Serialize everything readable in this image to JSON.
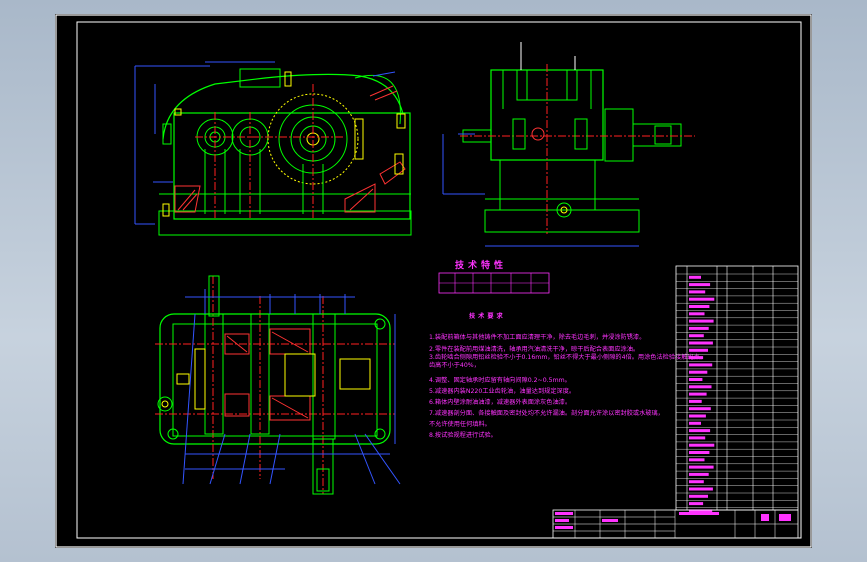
{
  "drawing": {
    "tech_chars_title": "技术特性",
    "tech_reqs_title": "技术要求",
    "notes": [
      "1.装配前箱体与其他铸件不加工面应清理干净，除去毛边毛刺，并浸涂防锈漆。",
      "2.零件在装配前用煤油清洗，轴承用汽油清洗干净，晾干后配合表面应涂油。",
      "3.齿轮啮合侧隙用铅丝检验不小于0.16mm，铅丝不得大于最小侧隙的4倍。用涂色法检验接触斑点，",
      "齿高不小于40%，",
      "4.调整、固定轴承时应留有轴向间隙0.2~0.5mm。",
      "5.减速器内装N220工业齿轮油，油量达到规定深度。",
      "6.箱体内壁涂耐油油漆，减速器外表面涂灰色油漆。",
      "7.减速器剖分面、各接触面及密封处均不允许漏油。剖分面允许涂以密封胶或水玻璃，",
      "不允许使用任何填料。",
      "8.按试验规程进行试验。"
    ]
  },
  "colors": {
    "background": "#000000",
    "frame": "#ffffff",
    "geometry": "#00ff00",
    "bolts": "#ffff00",
    "centerlines": "#ff2020",
    "dimensions": "#3355ff",
    "section": "#ff3333",
    "text": "#ff33ff"
  }
}
